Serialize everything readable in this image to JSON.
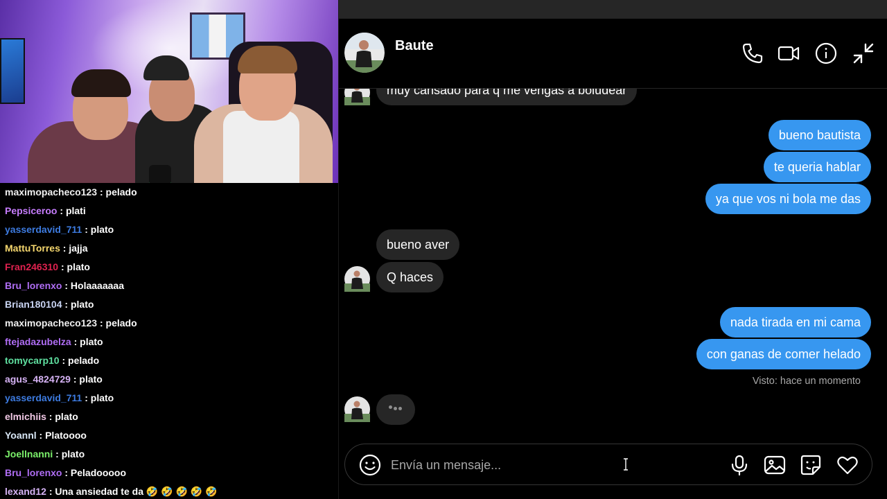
{
  "stream": {
    "webcam_label": "",
    "chat": [
      {
        "user": "maximopacheco123",
        "color": "#f0f0f0",
        "message": "pelado"
      },
      {
        "user": "Pepsiceroo",
        "color": "#c77dff",
        "message": "plati"
      },
      {
        "user": "yasserdavid_711",
        "color": "#3d7be0",
        "message": "plato"
      },
      {
        "user": "MattuTorres",
        "color": "#f5d76e",
        "message": "jajja"
      },
      {
        "user": "Fran246310",
        "color": "#e0224f",
        "message": "plato"
      },
      {
        "user": "Bru_lorenxo",
        "color": "#b06ef5",
        "message": "Holaaaaaaa"
      },
      {
        "user": "Brian180104",
        "color": "#c9d4f2",
        "message": "plato"
      },
      {
        "user": "maximopacheco123",
        "color": "#f0f0f0",
        "message": "pelado"
      },
      {
        "user": "ftejadazubelza",
        "color": "#b06ef5",
        "message": "plato"
      },
      {
        "user": "tomycarp10",
        "color": "#5fe0a0",
        "message": "pelado"
      },
      {
        "user": "agus_4824729",
        "color": "#d6b3f5",
        "message": "plato"
      },
      {
        "user": "yasserdavid_711",
        "color": "#3d7be0",
        "message": "plato"
      },
      {
        "user": "elmichiis",
        "color": "#f2c9e6",
        "message": "plato"
      },
      {
        "user": "Yoannl",
        "color": "#d8e6f5",
        "message": "Platoooo"
      },
      {
        "user": "Joellnanni",
        "color": "#7cf26b",
        "message": "plato"
      },
      {
        "user": "Bru_lorenxo",
        "color": "#b06ef5",
        "message": "Peladooooo"
      },
      {
        "user": "lexand12",
        "color": "#d6b3f5",
        "message": "Una ansiedad te da 🤣 🤣 🤣 🤣 🤣"
      }
    ]
  },
  "dm": {
    "contact_name": "Baute",
    "header_icons": [
      "phone-icon",
      "video-icon",
      "info-icon",
      "minimize-icon"
    ],
    "messages": [
      {
        "side": "in",
        "text": "muy cansado para q me vengas a boludear"
      },
      {
        "side": "out",
        "text": "bueno bautista"
      },
      {
        "side": "out",
        "text": "te queria hablar"
      },
      {
        "side": "out",
        "text": "ya que vos ni bola me das"
      },
      {
        "side": "in",
        "text": "bueno aver"
      },
      {
        "side": "in",
        "text": "Q haces"
      },
      {
        "side": "out",
        "text": "nada tirada en mi cama"
      },
      {
        "side": "out",
        "text": "con ganas de comer helado"
      }
    ],
    "seen_status": "Visto: hace un momento",
    "composer": {
      "placeholder": "Envía un mensaje...",
      "value": "",
      "icons": [
        "emoji-icon",
        "microphone-icon",
        "image-icon",
        "sticker-icon",
        "heart-icon"
      ]
    },
    "colors": {
      "outgoing_bubble": "#3797f0",
      "incoming_bubble": "#262626",
      "background": "#000000"
    }
  }
}
